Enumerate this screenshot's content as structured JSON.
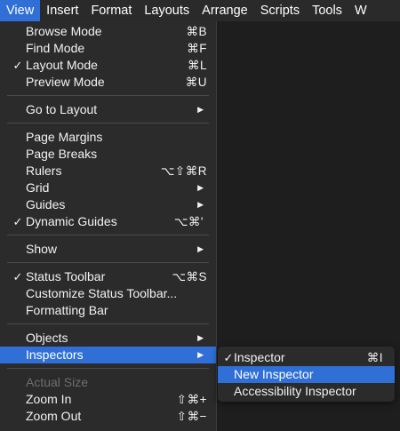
{
  "menubar": {
    "items": [
      "View",
      "Insert",
      "Format",
      "Layouts",
      "Arrange",
      "Scripts",
      "Tools",
      "W"
    ]
  },
  "view_menu": {
    "browse_mode": {
      "label": "Browse Mode",
      "shortcut": "⌘B"
    },
    "find_mode": {
      "label": "Find Mode",
      "shortcut": "⌘F"
    },
    "layout_mode": {
      "check": "✓",
      "label": "Layout Mode",
      "shortcut": "⌘L"
    },
    "preview_mode": {
      "label": "Preview Mode",
      "shortcut": "⌘U"
    },
    "go_to_layout": {
      "label": "Go to Layout",
      "arrow": "▶"
    },
    "page_margins": {
      "label": "Page Margins"
    },
    "page_breaks": {
      "label": "Page Breaks"
    },
    "rulers": {
      "label": "Rulers",
      "shortcut": "⌥⇧⌘R"
    },
    "grid": {
      "label": "Grid",
      "arrow": "▶"
    },
    "guides": {
      "label": "Guides",
      "arrow": "▶"
    },
    "dynamic_guides": {
      "check": "✓",
      "label": "Dynamic Guides",
      "shortcut": "⌥⌘'"
    },
    "show": {
      "label": "Show",
      "arrow": "▶"
    },
    "status_toolbar": {
      "check": "✓",
      "label": "Status Toolbar",
      "shortcut": "⌥⌘S"
    },
    "customize_status_toolbar": {
      "label": "Customize Status Toolbar..."
    },
    "formatting_bar": {
      "label": "Formatting Bar"
    },
    "objects": {
      "label": "Objects",
      "arrow": "▶"
    },
    "inspectors": {
      "label": "Inspectors",
      "arrow": "▶"
    },
    "actual_size": {
      "label": "Actual Size"
    },
    "zoom_in": {
      "label": "Zoom In",
      "shortcut": "⇧⌘+"
    },
    "zoom_out": {
      "label": "Zoom Out",
      "shortcut": "⇧⌘−"
    }
  },
  "inspectors_submenu": {
    "inspector": {
      "check": "✓",
      "label": "Inspector",
      "shortcut": "⌘I"
    },
    "new_inspector": {
      "label": "New Inspector"
    },
    "accessibility_inspector": {
      "label": "Accessibility Inspector"
    }
  },
  "colors": {
    "highlight": "#2f6fd6",
    "menu_bg": "#2b2b2b",
    "menubar_bg": "#2a2a2a",
    "disabled_text": "#6e6e6e"
  }
}
